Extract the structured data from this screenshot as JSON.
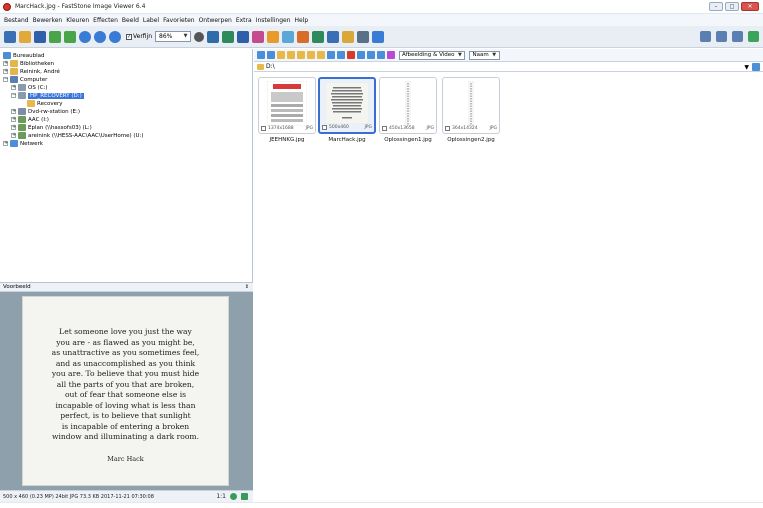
{
  "window": {
    "title": "MarcHack.jpg - FastStone Image Viewer 6.4"
  },
  "menu": [
    "Bestand",
    "Bewerken",
    "Kleuren",
    "Effecten",
    "Beeld",
    "Label",
    "Favorieten",
    "Ontwerpen",
    "Extra",
    "Instellingen",
    "Help"
  ],
  "toolbar": {
    "fit_label": "Verfijn",
    "fit_checked": "✓",
    "zoom_value": "86%"
  },
  "tree": {
    "items": [
      {
        "label": "Bureaublad",
        "icon": "desktop-icon",
        "expander": ""
      },
      {
        "label": "Bibliotheken",
        "icon": "library-icon",
        "expander": "+"
      },
      {
        "label": "Reinink, André",
        "icon": "user-folder-icon",
        "expander": "+"
      },
      {
        "label": "Computer",
        "icon": "computer-icon",
        "expander": "−"
      },
      {
        "label": "OS (C:)",
        "icon": "drive-icon",
        "expander": "+"
      },
      {
        "label": "HP_RECOVERY (D:)",
        "icon": "drive-icon",
        "expander": "−"
      },
      {
        "label": "Recovery",
        "icon": "folder-icon",
        "expander": ""
      },
      {
        "label": "Dvd-rw-station (E:)",
        "icon": "dvd-drive-icon",
        "expander": "+"
      },
      {
        "label": "AAC (I:)",
        "icon": "network-drive-icon",
        "expander": "+"
      },
      {
        "label": "Eplan (\\\\hassofs03) (L:)",
        "icon": "network-drive-icon",
        "expander": "+"
      },
      {
        "label": "areinink (\\\\HESS-AAC\\AAC\\UserHome) (U:)",
        "icon": "network-drive-icon",
        "expander": "+"
      },
      {
        "label": "Netwerk",
        "icon": "network-icon",
        "expander": "+"
      }
    ]
  },
  "preview": {
    "header": "Voorbeeld",
    "pin": "⇕",
    "quote_lines": [
      "Let someone love you just the way",
      "you are - as flawed as you might be,",
      "as unattractive as you sometimes feel,",
      "and as unaccomplished as you think",
      "you are. To believe that you must hide",
      "all the parts of you that are broken,",
      "out of fear that someone else is",
      "incapable of loving what is less than",
      "perfect, is to believe that sunlight",
      "is incapable of entering a broken",
      "window and illuminating a dark room."
    ],
    "quote_author": "Marc Hack"
  },
  "statusbar": {
    "info": "500 x 460 (0.23 MP)  24bit  JPG   73.3 KB   2017-11-21 07:30:08",
    "ratio": "1:1"
  },
  "browser": {
    "filter_value": "Afbeelding & Video",
    "sort_value": "Naam",
    "path": "D:\\",
    "thumbnails": [
      {
        "name": "JEEHNKG.jpg",
        "dims": "1374x1688",
        "ext": "JPG",
        "selected": false
      },
      {
        "name": "MarcHack.jpg",
        "dims": "500x460",
        "ext": "JPG",
        "selected": true
      },
      {
        "name": "Oplossingen1.jpg",
        "dims": "450x13658",
        "ext": "JPG",
        "selected": false
      },
      {
        "name": "Oplossingen2.jpg",
        "dims": "364x14324",
        "ext": "JPG",
        "selected": false
      }
    ]
  },
  "colors": {
    "accent": "#3a6fd0",
    "selection": "#3a75d8",
    "preview_bg": "#8fa0ad"
  }
}
